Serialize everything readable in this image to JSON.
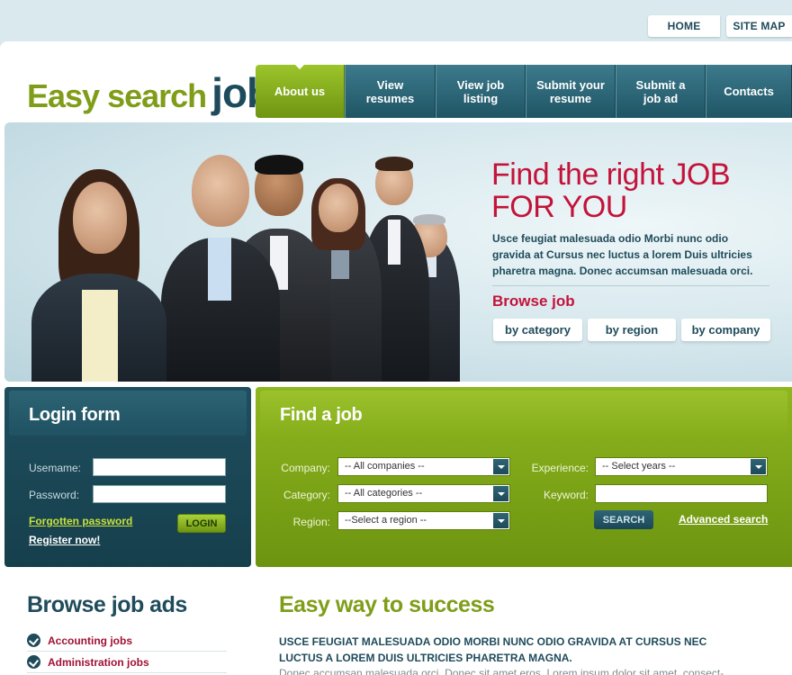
{
  "top_links": {
    "home": "HOME",
    "sitemap": "SITE MAP"
  },
  "logo": {
    "part1": "Easy search",
    "part2": "job"
  },
  "nav": {
    "about": "About us",
    "view_resumes": "View resumes",
    "view_listing": "View job listing",
    "submit_resume": "Submit your resume",
    "submit_ad": "Submit a job ad",
    "contacts": "Contacts"
  },
  "hero": {
    "title_line1": "Find the right JOB",
    "title_line2": "FOR YOU",
    "text": "Usce feugiat malesuada odio Morbi nunc odio gravida at Cursus nec luctus a lorem  Duis ultricies pharetra magna. Donec accumsan malesuada orci.",
    "browse_title": "Browse job",
    "by_category": "by category",
    "by_region": "by region",
    "by_company": "by company"
  },
  "login": {
    "title": "Login form",
    "username_label": "Usemame:",
    "password_label": "Password:",
    "username_value": "",
    "password_value": "",
    "forgot": "Forgotten password",
    "register": "Register now!",
    "button": "LOGIN"
  },
  "find": {
    "title": "Find a job",
    "company_label": "Company:",
    "company_value": "-- All companies --",
    "category_label": "Category:",
    "category_value": "-- All categories --",
    "region_label": "Region:",
    "region_value": "--Select a region --",
    "experience_label": "Experience:",
    "experience_value": "-- Select years --",
    "keyword_label": "Keyword:",
    "keyword_value": "",
    "search_button": "SEARCH",
    "advanced": "Advanced search"
  },
  "browse_ads": {
    "title": "Browse job ads",
    "items": [
      "Accounting jobs",
      "Administration jobs"
    ]
  },
  "easy_way": {
    "title": "Easy way to success",
    "lead": "USCE FEUGIAT MALESUADA ODIO MORBI NUNC ODIO GRAVIDA AT CURSUS NEC LUCTUS A LOREM  DUIS ULTRICIES PHARETRA MAGNA.",
    "body": "Donec accumsan malesuada orci. Donec sit amet eros. Lorem ipsum dolor sit amet, consect-"
  },
  "colors": {
    "brand_teal": "#1f4b5b",
    "brand_green": "#7f9d19",
    "accent_red": "#c4133a"
  }
}
